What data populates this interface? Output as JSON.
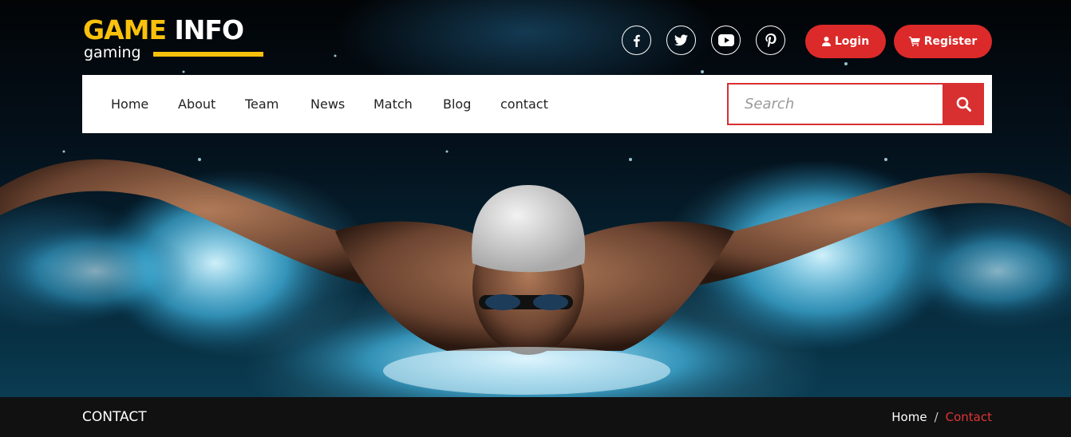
{
  "brand": {
    "title_primary": "GAME",
    "title_secondary": "INFO",
    "subtitle": "gaming",
    "colors": {
      "accent": "#f9c10c",
      "red": "#dc2a2a"
    }
  },
  "social": [
    {
      "icon": "facebook-icon",
      "label": "f"
    },
    {
      "icon": "twitter-icon"
    },
    {
      "icon": "youtube-icon"
    },
    {
      "icon": "pinterest-icon"
    }
  ],
  "auth": {
    "login_label": "Login",
    "register_label": "Register"
  },
  "nav": {
    "items": [
      {
        "label": "Home"
      },
      {
        "label": "About"
      },
      {
        "label": "Team"
      },
      {
        "label": "News"
      },
      {
        "label": "Match"
      },
      {
        "label": "Blog"
      },
      {
        "label": "contact"
      }
    ],
    "search": {
      "placeholder": "Search",
      "value": ""
    }
  },
  "breadcrumb": {
    "page_title": "CONTACT",
    "home": "Home",
    "separator": "/",
    "current": "Contact"
  }
}
